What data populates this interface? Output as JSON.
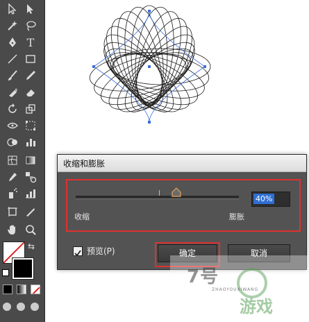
{
  "toolbar": {
    "tools": [
      {
        "name": "selection-tool-icon"
      },
      {
        "name": "direct-selection-tool-icon"
      },
      {
        "name": "magic-wand-tool-icon"
      },
      {
        "name": "lasso-tool-icon"
      },
      {
        "name": "pen-tool-icon"
      },
      {
        "name": "type-tool-icon"
      },
      {
        "name": "line-tool-icon"
      },
      {
        "name": "rectangle-tool-icon"
      },
      {
        "name": "paintbrush-tool-icon"
      },
      {
        "name": "pencil-tool-icon"
      },
      {
        "name": "blob-brush-tool-icon"
      },
      {
        "name": "eraser-tool-icon"
      },
      {
        "name": "rotate-tool-icon"
      },
      {
        "name": "scale-tool-icon"
      },
      {
        "name": "width-tool-icon"
      },
      {
        "name": "free-transform-tool-icon"
      },
      {
        "name": "shape-builder-tool-icon"
      },
      {
        "name": "graph-tool-icon"
      },
      {
        "name": "mesh-tool-icon"
      },
      {
        "name": "gradient-tool-icon"
      },
      {
        "name": "eyedropper-tool-icon"
      },
      {
        "name": "blend-tool-icon"
      },
      {
        "name": "symbol-sprayer-tool-icon"
      },
      {
        "name": "column-graph-tool-icon"
      },
      {
        "name": "artboard-tool-icon"
      },
      {
        "name": "slice-tool-icon"
      },
      {
        "name": "hand-tool-icon"
      },
      {
        "name": "zoom-tool-icon"
      }
    ],
    "text": {
      "type_tool": "T"
    },
    "fill_color": "#ffffff",
    "stroke_color": "#000000"
  },
  "dialog": {
    "title": "收缩和膨胀",
    "slider": {
      "value_text": "40%",
      "value": 40,
      "min_label": "收缩",
      "max_label": "膨胀"
    },
    "preview": {
      "label": "预览(P)",
      "checked": true
    },
    "ok_label": "确定",
    "cancel_label": "取消"
  },
  "watermark": {
    "main": "7号",
    "sub": "ZHAOYOUXIWANG",
    "game": "游戏"
  },
  "colors": {
    "highlight": "#e03030",
    "selection": "#2f6fd3",
    "dialog_bg": "#535353",
    "toolbar_bg": "#4a4a4a"
  }
}
